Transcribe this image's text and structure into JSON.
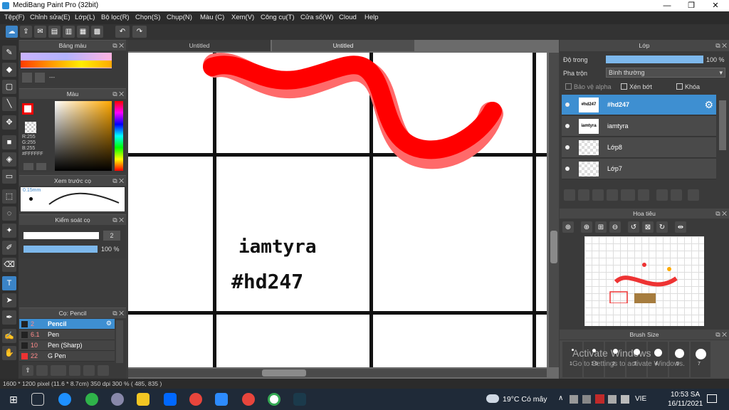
{
  "window": {
    "title": "MediBang Paint Pro (32bit)",
    "minimize": "—",
    "maximize": "❐",
    "close": "✕"
  },
  "menu": [
    "Tệp(F)",
    "Chỉnh sửa(E)",
    "Lớp(L)",
    "Bộ lọc(R)",
    "Chọn(S)",
    "Chụp(N)",
    "Màu (C)",
    "Xem(V)",
    "Công cụ(T)",
    "Cửa sổ(W)",
    "Cloud",
    "Help"
  ],
  "tabs": [
    "Untitled",
    "Untitled"
  ],
  "palette": {
    "title": "Bảng màu",
    "more": "---"
  },
  "color": {
    "title": "Màu",
    "r": "R:255",
    "g": "G:255",
    "b": "B:255",
    "hex": "#FFFFFF"
  },
  "brush_preview": {
    "title": "Xem trước cọ",
    "size": "0.15mm"
  },
  "brush_control": {
    "title": "Kiểm soát cọ",
    "size_value": "2",
    "opacity_value": "100 %",
    "opacity": 1.0
  },
  "brush_list": {
    "title": "Cọ: Pencil",
    "items": [
      {
        "size": "2",
        "name": "Pencil",
        "selected": true
      },
      {
        "size": "6.1",
        "name": "Pen",
        "selected": false
      },
      {
        "size": "10",
        "name": "Pen (Sharp)",
        "selected": false
      },
      {
        "size": "22",
        "name": "G Pen",
        "selected": false
      }
    ]
  },
  "canvas": {
    "text1": "iamtyra",
    "text2": "#hd247"
  },
  "layers": {
    "title": "Lớp",
    "opacity_label": "Độ trong",
    "opacity_value": "100 %",
    "opacity": 1.0,
    "blend_label": "Pha trộn",
    "blend_value": "Bình thường",
    "protect_alpha": "Bảo vệ alpha",
    "clipping": "Xén bớt",
    "lock": "Khóa",
    "items": [
      {
        "name": "#hd247",
        "thumb": "#hd247",
        "selected": true
      },
      {
        "name": "iamtyra",
        "thumb": "iamtyra",
        "selected": false
      },
      {
        "name": "Lớp8",
        "thumb": "",
        "selected": false
      },
      {
        "name": "Lớp7",
        "thumb": "",
        "selected": false
      }
    ]
  },
  "navigator": {
    "title": "Hoa tiêu"
  },
  "brush_size": {
    "title": "Brush Size",
    "sizes": [
      "1",
      "1.5",
      "2",
      "3",
      "4",
      "5",
      "7"
    ]
  },
  "activate": {
    "line1": "Activate Windows",
    "line2": "Go to Settings to activate Windows."
  },
  "status": {
    "text": "1600 * 1200 pixel   (11.6 * 8.7cm)   350 dpi   300 %   ( 485, 835 )"
  },
  "taskbar": {
    "weather": "19°C  Có mây",
    "lang": "VIE",
    "time": "10:53 SA",
    "date": "16/11/2021"
  },
  "colors": {
    "accent": "#3e8fd1",
    "stroke_red": "#ff0000",
    "stroke_pink": "#ff6a6a"
  }
}
